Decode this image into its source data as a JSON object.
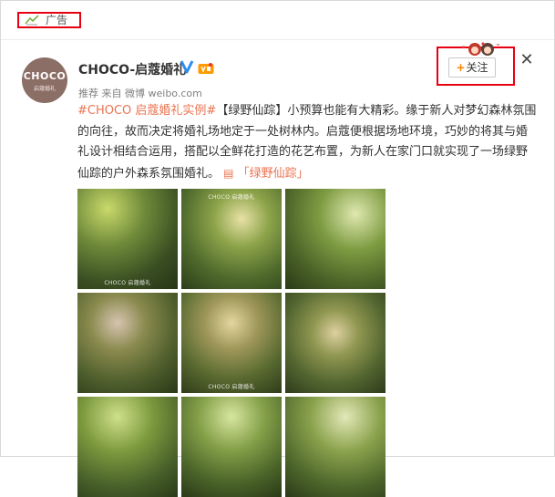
{
  "ad": {
    "label": "广告",
    "icon": "promotion-icon"
  },
  "author": {
    "avatar_logo": "CHOCO",
    "avatar_sub": "启蔻婚礼",
    "name": "CHOCO-启蔻婚礼",
    "verified_icon": "verified-v-icon",
    "vip_icon": "vip-icon"
  },
  "meta": {
    "recommend": "推荐",
    "source": "来自 微博 weibo.com"
  },
  "follow": {
    "label": "关注",
    "plus": "+",
    "close": "✕"
  },
  "post": {
    "tag": "#CHOCO 启蔻婚礼实例#",
    "body": "【绿野仙踪】小预算也能有大精彩。缘于新人对梦幻森林氛围的向往，故而决定将婚礼场地定于一处树林内。启蔻便根据场地环境，巧妙的将其与婚礼设计相结合运用，搭配以全鲜花打造的花艺布置，为新人在家门口就实现了一场绿野仙踪的户外森系氛围婚礼。",
    "link_icon": "article-icon",
    "link_text": "「绿野仙踪」"
  },
  "photos": {
    "watermark": "CHOCO 启蔻婚礼",
    "items": [
      {
        "alt": "forest wedding photo 1"
      },
      {
        "alt": "forest wedding photo 2"
      },
      {
        "alt": "forest wedding photo 3"
      },
      {
        "alt": "forest wedding photo 4"
      },
      {
        "alt": "forest wedding photo 5"
      },
      {
        "alt": "forest wedding photo 6"
      },
      {
        "alt": "forest wedding photo 7"
      },
      {
        "alt": "forest wedding photo 8"
      },
      {
        "alt": "forest wedding photo 9"
      }
    ]
  },
  "colors": {
    "accent": "#eb7350",
    "follow_plus": "#ff8200",
    "highlight_box": "#e60012"
  }
}
